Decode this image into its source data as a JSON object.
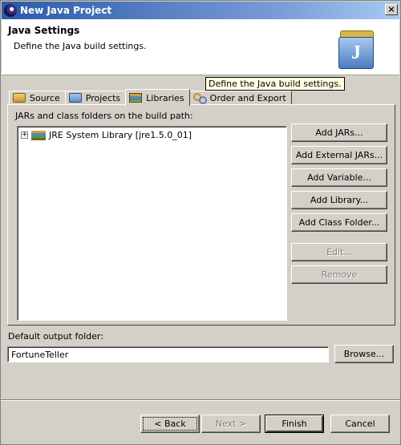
{
  "window": {
    "title": "New Java Project",
    "close_glyph": "×"
  },
  "banner": {
    "title": "Java Settings",
    "description": "Define the Java build settings."
  },
  "tooltip": "Define the Java build settings.",
  "tabs": [
    {
      "label": "Source",
      "icon": "source-folder-icon"
    },
    {
      "label": "Projects",
      "icon": "projects-icon"
    },
    {
      "label": "Libraries",
      "icon": "libraries-icon",
      "active": true
    },
    {
      "label": "Order and Export",
      "icon": "order-export-icon"
    }
  ],
  "panel": {
    "label": "JARs and class folders on the build path:",
    "tree_items": [
      {
        "label": "JRE System Library [jre1.5.0_01]",
        "expander": "+"
      }
    ],
    "buttons": {
      "add_jars": "Add JARs...",
      "add_external_jars": "Add External JARs...",
      "add_variable": "Add Variable...",
      "add_library": "Add Library...",
      "add_class_folder": "Add Class Folder...",
      "edit": "Edit...",
      "remove": "Remove"
    }
  },
  "output": {
    "label": "Default output folder:",
    "value": "FortuneTeller",
    "browse": "Browse..."
  },
  "footer": {
    "back": "< Back",
    "next": "Next >",
    "finish": "Finish",
    "cancel": "Cancel"
  }
}
